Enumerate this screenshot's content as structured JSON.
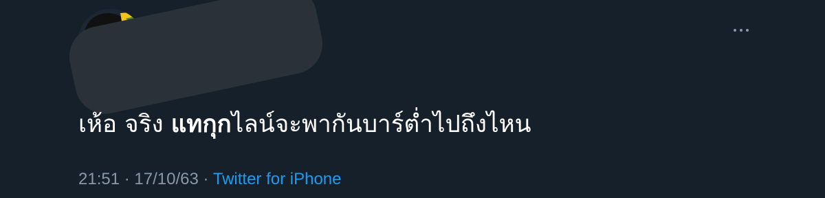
{
  "tweet": {
    "text_part1": "เห้อ จริง ",
    "text_bold": "แทกุก",
    "text_part2": "ไลน์จะพากันบาร์ต่ำไปถึงไหน",
    "time": "21:51",
    "date": "17/10/63",
    "separator": "·",
    "source": "Twitter for iPhone"
  },
  "icons": {
    "avatar": "avatar-photo",
    "more": "more-horizontal-icon"
  },
  "colors": {
    "background": "#15202b",
    "text": "#ffffff",
    "secondary_text": "#8b98a5",
    "link": "#1d9bf0",
    "redaction": "#2a3138"
  }
}
